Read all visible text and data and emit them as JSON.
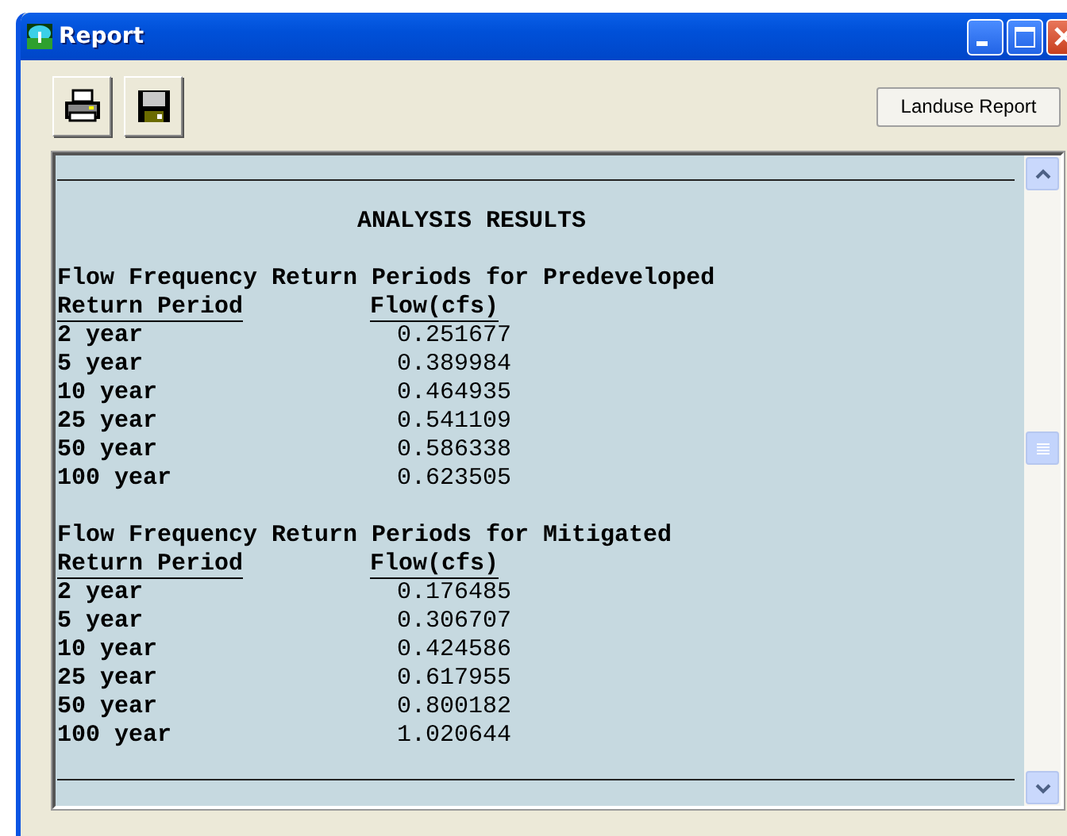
{
  "window": {
    "title": "Report"
  },
  "toolbar": {
    "buttons": [
      {
        "kind": "print"
      },
      {
        "kind": "save"
      }
    ],
    "landuse_button": "Landuse Report"
  },
  "report": {
    "title": "ANALYSIS RESULTS",
    "sections": [
      {
        "heading": "Flow Frequency Return Periods for Predeveloped",
        "columns": [
          "Return Period",
          "Flow(cfs)"
        ],
        "rows": [
          {
            "period": "2 year",
            "flow": "0.251677"
          },
          {
            "period": "5 year",
            "flow": "0.389984"
          },
          {
            "period": "10 year",
            "flow": "0.464935"
          },
          {
            "period": "25 year",
            "flow": "0.541109"
          },
          {
            "period": "50 year",
            "flow": "0.586338"
          },
          {
            "period": "100 year",
            "flow": "0.623505"
          }
        ]
      },
      {
        "heading": "Flow Frequency Return Periods for Mitigated",
        "columns": [
          "Return Period",
          "Flow(cfs)"
        ],
        "rows": [
          {
            "period": "2 year",
            "flow": "0.176485"
          },
          {
            "period": "5 year",
            "flow": "0.306707"
          },
          {
            "period": "10 year",
            "flow": "0.424586"
          },
          {
            "period": "25 year",
            "flow": "0.617955"
          },
          {
            "period": "50 year",
            "flow": "0.800182"
          },
          {
            "period": "100 year",
            "flow": "1.020644"
          }
        ]
      }
    ]
  }
}
